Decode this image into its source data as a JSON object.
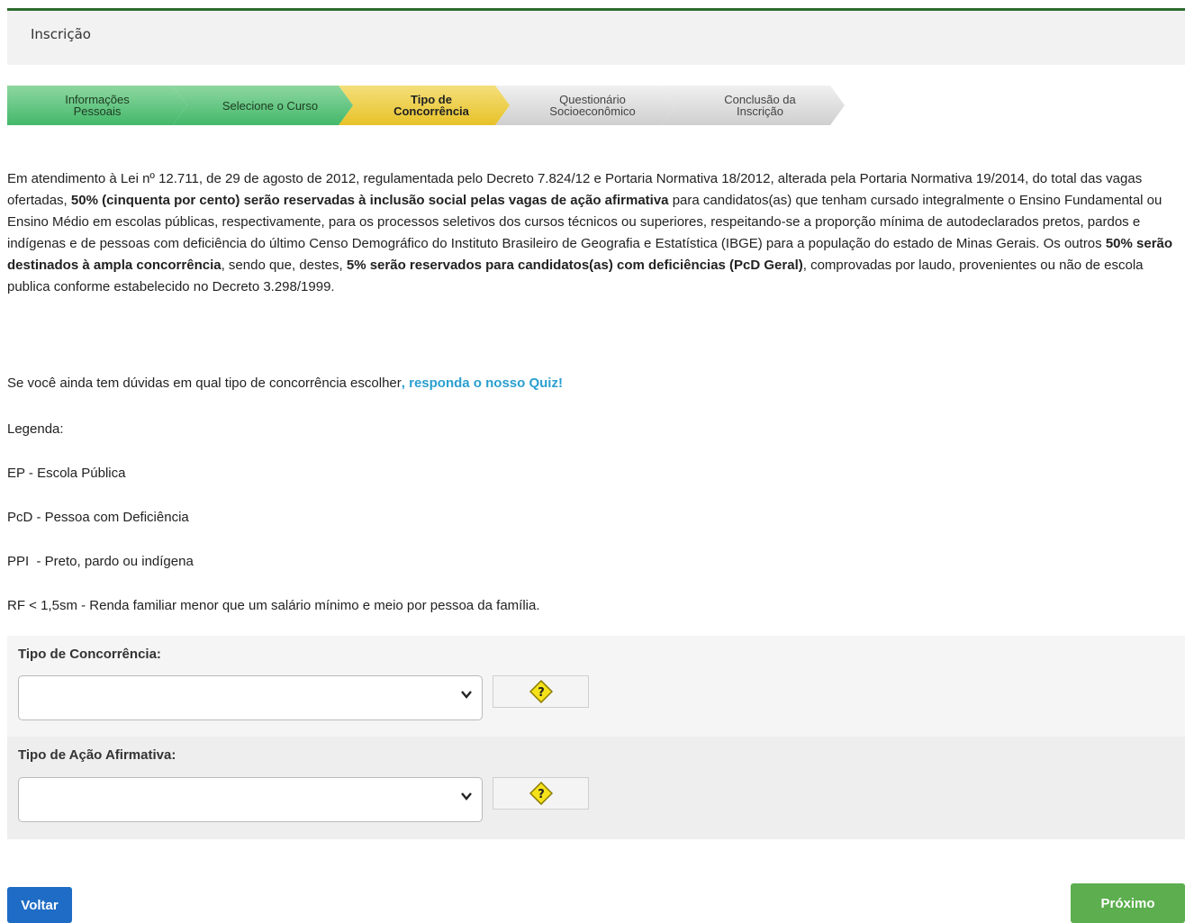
{
  "header": {
    "title": "Inscrição"
  },
  "steps": [
    {
      "line1": "Informações",
      "line2": "Pessoais",
      "state": "done"
    },
    {
      "line1": "Selecione o Curso",
      "line2": "",
      "state": "done"
    },
    {
      "line1": "Tipo de",
      "line2": "Concorrência",
      "state": "current"
    },
    {
      "line1": "Questionário",
      "line2": "Socioeconômico",
      "state": "todo"
    },
    {
      "line1": "Conclusão da",
      "line2": "Inscrição",
      "state": "todo"
    }
  ],
  "intro": {
    "part1": "Em atendimento à Lei nº 12.711, de 29 de agosto de 2012, regulamentada pelo Decreto 7.824/12 e Portaria Normativa 18/2012, alterada pela Portaria Normativa 19/2014, do total das vagas ofertadas, ",
    "bold1": "50% (cinquenta por cento) serão reservadas à inclusão social pelas vagas de ação afirmativa",
    "part2": " para candidatos(as) que tenham cursado integralmente o Ensino Fundamental ou Ensino Médio em escolas públicas, respectivamente, para os processos seletivos dos cursos técnicos ou superiores, respeitando-se a proporção mínima de autodeclarados pretos, pardos e indígenas e de pessoas com deficiência do último Censo Demográfico do Instituto Brasileiro de Geografia e Estatística (IBGE) para a população do estado de Minas Gerais. Os outros ",
    "bold2": "50% serão destinados à ampla concorrência",
    "part3": ", sendo que, destes, ",
    "bold3": "5% serão reservados para candidatos(as) com deficiências (PcD Geral)",
    "part4": ", comprovadas por laudo, provenientes ou não de escola publica conforme estabelecido no Decreto 3.298/1999."
  },
  "quiz": {
    "text": "Se você ainda tem dúvidas em qual tipo de concorrência escolher",
    "link": ", responda o nosso Quiz!"
  },
  "legend": {
    "title": "Legenda:",
    "items": [
      "EP - Escola Pública",
      "PcD - Pessoa com Deficiência",
      "PPI  - Preto, pardo ou indígena",
      "RF < 1,5sm - Renda familiar menor que um salário mínimo e meio por pessoa da família."
    ]
  },
  "form": {
    "concorrencia_label": "Tipo de Concorrência:",
    "concorrencia_value": "",
    "acao_label": "Tipo de Ação Afirmativa:",
    "acao_value": ""
  },
  "buttons": {
    "back": "Voltar",
    "next": "Próximo"
  },
  "colors": {
    "header_border": "#2d6b2f",
    "link": "#2a9fcf",
    "back_button": "#1e6cc5",
    "next_button": "#5cae4e",
    "help_icon": "#f5e21b"
  }
}
